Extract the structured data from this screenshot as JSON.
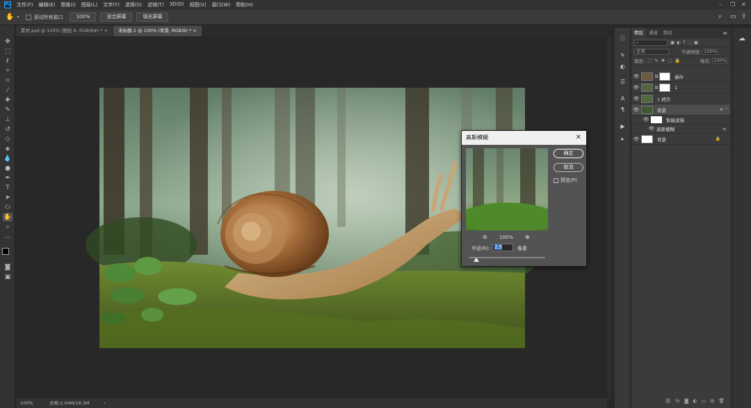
{
  "app": {
    "logo": "Ps"
  },
  "menu": [
    "文件(F)",
    "编辑(E)",
    "图像(I)",
    "图层(L)",
    "文字(Y)",
    "选择(S)",
    "滤镜(T)",
    "3D(D)",
    "视图(V)",
    "窗口(W)",
    "帮助(H)"
  ],
  "options": {
    "scroll_all_label": "滚动所有窗口",
    "zoom_value": "100%",
    "fit_screen_label": "适合屏幕",
    "fill_screen_label": "填充屏幕"
  },
  "tabs": [
    {
      "label": "素材.psd @ 100% (图层 6, RGB/8#) *  ×"
    },
    {
      "label": "未标题-1 @ 100% (背景, RGB/8) *  ×"
    }
  ],
  "status": {
    "zoom": "100%",
    "doc": "文档:2.04M/18.3M"
  },
  "layers_panel": {
    "tabs": [
      "图层",
      "通道",
      "路径"
    ],
    "blend_mode": "正常",
    "opacity_label": "不透明度:",
    "opacity_value": "100%",
    "lock_label": "锁定:",
    "fill_label": "填充:",
    "fill_value": "100%",
    "layers": [
      {
        "name": "蜗牛",
        "has_mask": true,
        "selected": false
      },
      {
        "name": "1",
        "has_mask": true,
        "selected": false
      },
      {
        "name": "1 拷贝",
        "has_mask": false,
        "selected": false
      },
      {
        "name": "背景",
        "has_mask": false,
        "selected": true,
        "smart": true
      }
    ],
    "smart_filters_label": "智能滤镜",
    "smart_filter_item": "高斯模糊",
    "background_layer": "背景"
  },
  "dialog": {
    "title": "高斯模糊",
    "ok_label": "确定",
    "cancel_label": "取消",
    "preview_label": "预览(P)",
    "zoom_level": "100%",
    "radius_label": "半径(R):",
    "radius_value": "2.5",
    "radius_unit": "像素",
    "radius_slider_fraction": 0.1
  },
  "colors": {
    "accent": "#31a8ff",
    "ui_bg": "#282828",
    "panel": "#3b3b3b"
  }
}
